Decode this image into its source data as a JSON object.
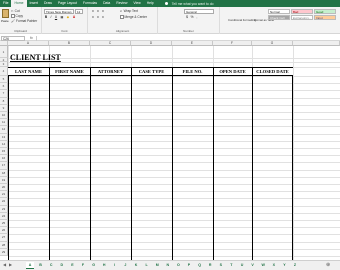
{
  "ribbon": {
    "tabs": [
      "File",
      "Home",
      "Insert",
      "Draw",
      "Page Layout",
      "Formulas",
      "Data",
      "Review",
      "View",
      "Help"
    ],
    "active_tab": "Home",
    "tell_me": "Tell me what you want to do",
    "clipboard": {
      "paste": "Paste",
      "cut": "Cut",
      "copy": "Copy",
      "format_painter": "Format Painter",
      "label": "Clipboard"
    },
    "font": {
      "name": "Times New Roman",
      "size": "12",
      "label": "Font"
    },
    "alignment": {
      "wrap_text": "Wrap Text",
      "merge_center": "Merge & Center",
      "label": "Alignment"
    },
    "number": {
      "format": "General",
      "label": "Number"
    },
    "styles": {
      "conditional": "Conditional Formatting",
      "format_as_table": "Format as Table",
      "normal": "Normal",
      "bad": "Bad",
      "check_cell": "Check Cell",
      "explanatory": "Explanatory...",
      "good": "Good",
      "input": "Input"
    }
  },
  "formula_bar": {
    "name_box": "C26",
    "fx": "fx",
    "formula": ""
  },
  "sheet": {
    "title": "CLIENT LIST",
    "columns": [
      "A",
      "B",
      "C",
      "D",
      "E",
      "F",
      "G"
    ],
    "table_headers": [
      "LAST NAME",
      "FIRST NAME",
      "ATTORNEY",
      "CASE TYPE",
      "FILE NO.",
      "OPEN DATE",
      "CLOSED DATE"
    ],
    "row_numbers": [
      "1",
      "2",
      "3",
      "4",
      "5",
      "6",
      "7",
      "8",
      "9",
      "10",
      "11",
      "12",
      "13",
      "14",
      "15",
      "16",
      "17",
      "18",
      "19",
      "20",
      "21",
      "22",
      "23",
      "24",
      "25",
      "26",
      "27",
      "28",
      "29"
    ]
  },
  "sheet_tabs": {
    "tabs": [
      "A",
      "B",
      "C",
      "D",
      "E",
      "F",
      "G",
      "H",
      "I",
      "J",
      "K",
      "L",
      "M",
      "N",
      "O",
      "P",
      "Q",
      "R",
      "S",
      "T",
      "U",
      "V",
      "W",
      "X",
      "Y",
      "Z"
    ],
    "active": "A"
  },
  "colors": {
    "excel_green": "#217346",
    "bad_fill": "#ffc7ce",
    "good_fill": "#c6efce",
    "neutral_fill": "#ffeb9c",
    "check_fill": "#a5a5a5"
  }
}
